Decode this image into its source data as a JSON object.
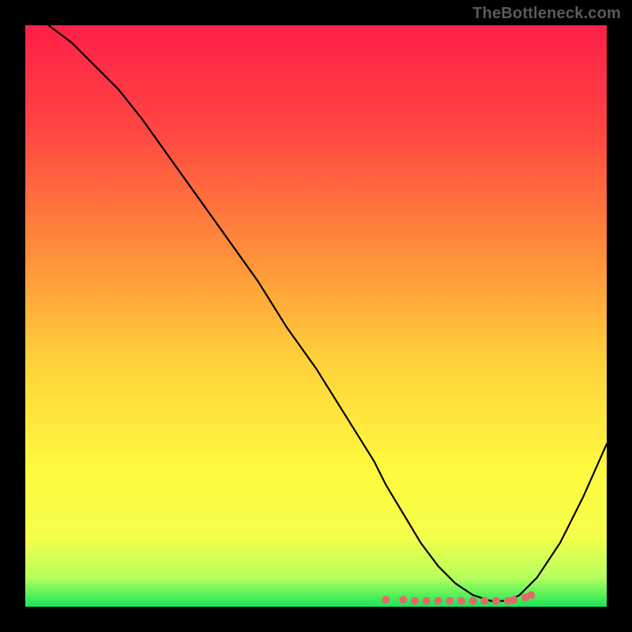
{
  "watermark": "TheBottleneck.com",
  "chart_data": {
    "type": "line",
    "title": "",
    "xlabel": "",
    "ylabel": "",
    "xlim": [
      0,
      100
    ],
    "ylim": [
      0,
      100
    ],
    "series": [
      {
        "name": "bottleneck-curve",
        "x": [
          4,
          8,
          12,
          16,
          20,
          25,
          30,
          35,
          40,
          45,
          50,
          55,
          60,
          62,
          65,
          68,
          71,
          74,
          77,
          80,
          83,
          85,
          88,
          92,
          96,
          100
        ],
        "values": [
          100,
          97,
          93,
          89,
          84,
          77,
          70,
          63,
          56,
          48,
          41,
          33,
          25,
          21,
          16,
          11,
          7,
          4,
          2,
          1,
          1,
          2,
          5,
          11,
          19,
          28
        ]
      }
    ],
    "markers": {
      "name": "optimal-range",
      "x": [
        62,
        65,
        67,
        69,
        71,
        73,
        75,
        77,
        79,
        81,
        83,
        84,
        86,
        87
      ],
      "values": [
        1.2,
        1.2,
        1.0,
        1.0,
        1.0,
        1.0,
        1.0,
        1.0,
        1.0,
        1.0,
        1.0,
        1.2,
        1.6,
        2.0
      ]
    },
    "gradient_stops": [
      {
        "offset": 0,
        "color": "#ff1f47"
      },
      {
        "offset": 18,
        "color": "#ff4642"
      },
      {
        "offset": 38,
        "color": "#ff8a3a"
      },
      {
        "offset": 58,
        "color": "#ffd23b"
      },
      {
        "offset": 76,
        "color": "#fff93e"
      },
      {
        "offset": 88,
        "color": "#f4ff4a"
      },
      {
        "offset": 95,
        "color": "#b6ff5d"
      },
      {
        "offset": 100,
        "color": "#19e658"
      }
    ]
  }
}
